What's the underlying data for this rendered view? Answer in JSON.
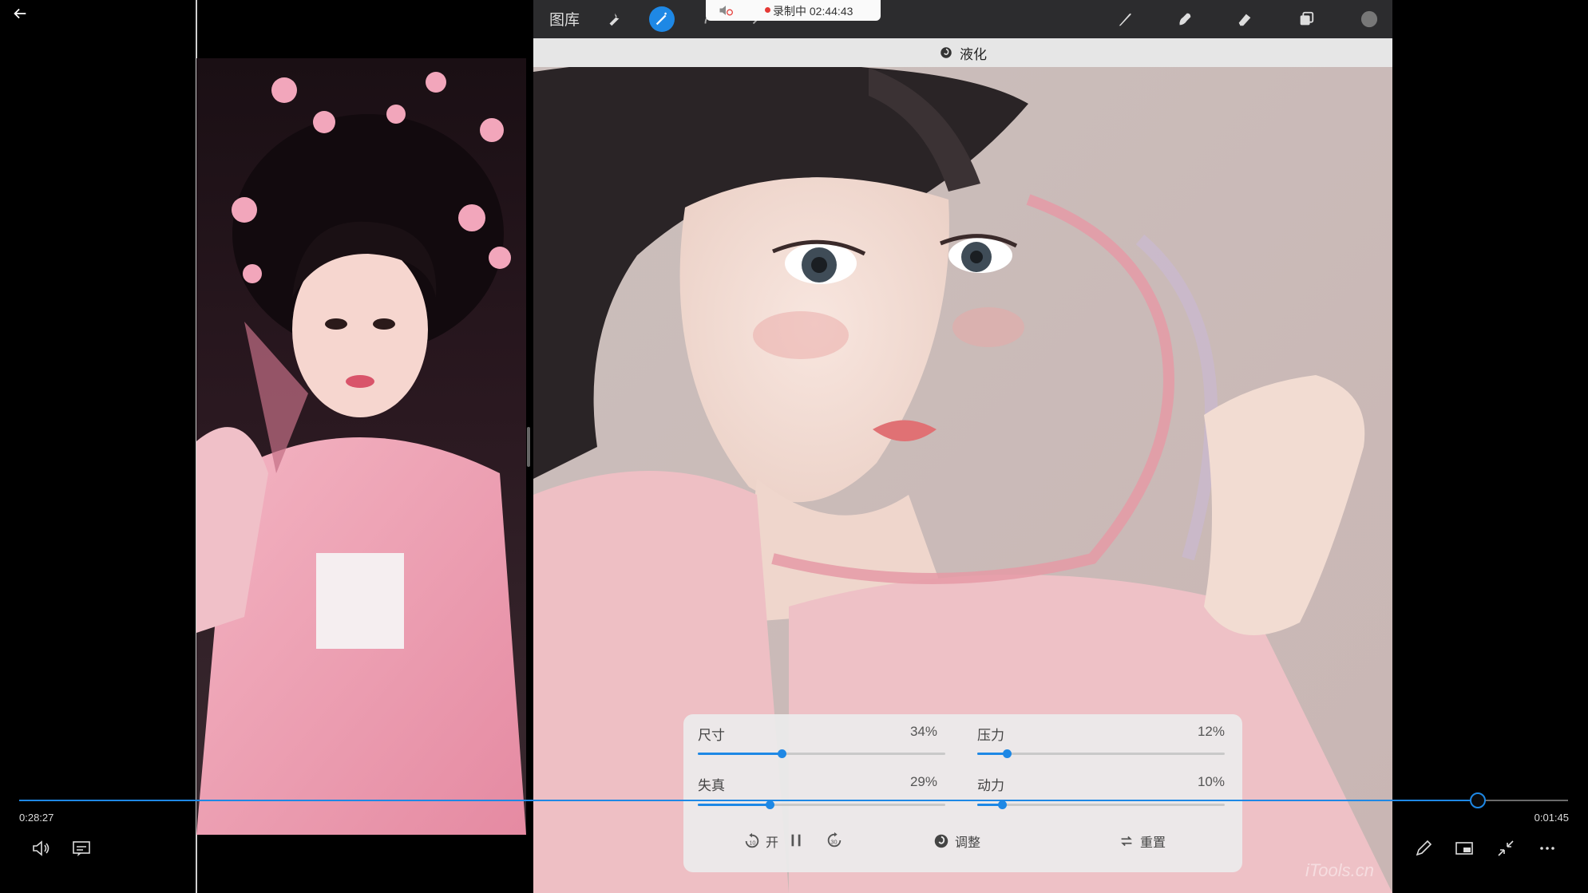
{
  "procreate": {
    "gallery_label": "图库",
    "mode_label": "液化",
    "recording": {
      "text": "录制中 02:44:43"
    },
    "panel": {
      "size": {
        "label": "尺寸",
        "value": "34%",
        "level": 0.34
      },
      "pressure": {
        "label": "压力",
        "value": "12%",
        "level": 0.12
      },
      "distortion": {
        "label": "失真",
        "value": "29%",
        "level": 0.29
      },
      "momentum": {
        "label": "动力",
        "value": "10%",
        "level": 0.1
      },
      "on_label": "开",
      "adjust_label": "调整",
      "reset_label": "重置"
    },
    "watermark": "iTools.cn"
  },
  "player": {
    "current_time": "0:28:27",
    "remaining_time": "0:01:45",
    "progress": 0.9418,
    "accent": "#1e88e5"
  },
  "icons": [
    "back-arrow-icon",
    "wrench-icon",
    "magic-wand-icon",
    "brush-icon",
    "smudge-icon",
    "eraser-icon",
    "layers-icon",
    "color-swatch",
    "liquify-icon",
    "speaker-icon",
    "rewind-10-icon",
    "pause-icon",
    "forward-30-icon",
    "adjust-icon",
    "reset-icon",
    "volume-icon",
    "subtitles-icon",
    "pen-icon",
    "mini-view-icon",
    "exit-fullscreen-icon",
    "more-icon"
  ]
}
